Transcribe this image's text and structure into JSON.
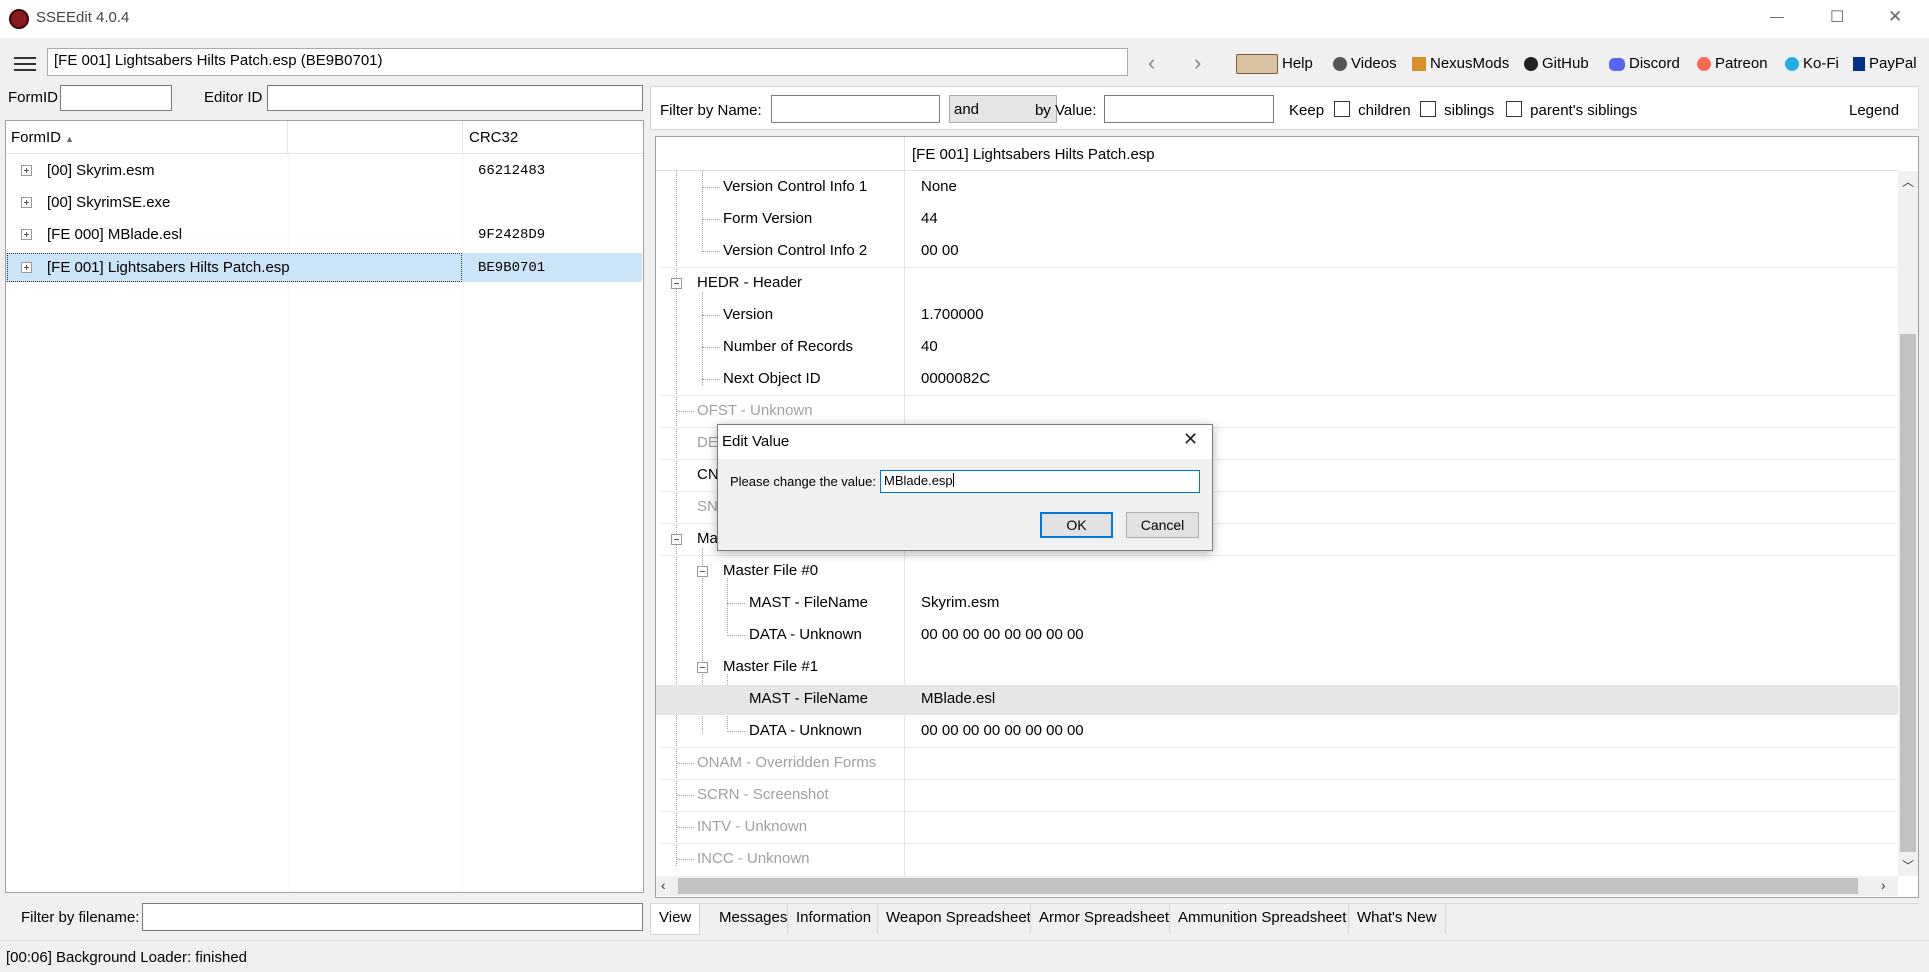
{
  "window": {
    "title": "SSEEdit 4.0.4",
    "buttons": {
      "minimize": "—",
      "maximize": "☐",
      "close": "✕"
    }
  },
  "toolbar": {
    "address": "[FE 001] Lightsabers Hilts Patch.esp (BE9B0701)",
    "links": [
      "Help",
      "Videos",
      "NexusMods",
      "GitHub",
      "Discord",
      "Patreon",
      "Ko-Fi",
      "PayPal"
    ]
  },
  "left": {
    "formid_label": "FormID",
    "formid_value": "",
    "editorid_label": "Editor ID",
    "editorid_value": "",
    "columns": [
      "FormID",
      "CRC32"
    ],
    "files": [
      {
        "name": "[00] Skyrim.esm",
        "crc": "66212483"
      },
      {
        "name": "[00] SkyrimSE.exe",
        "crc": ""
      },
      {
        "name": "[FE 000] MBlade.esl",
        "crc": "9F2428D9"
      },
      {
        "name": "[FE 001] Lightsabers Hilts Patch.esp",
        "crc": "BE9B0701"
      }
    ],
    "filter_label": "Filter by filename:",
    "filter_value": ""
  },
  "right": {
    "filter_name_label": "Filter by Name:",
    "filter_name_value": "",
    "operator": "and",
    "filter_value_label": "by Value:",
    "filter_value_value": "",
    "keep_label": "Keep",
    "checkboxes": [
      "children",
      "siblings",
      "parent's siblings"
    ],
    "legend": "Legend",
    "column_header": "[FE 001] Lightsabers Hilts Patch.esp",
    "rows": [
      {
        "label": "Version Control Info 1",
        "value": "None"
      },
      {
        "label": "Form Version",
        "value": "44"
      },
      {
        "label": "Version Control Info 2",
        "value": "00 00"
      },
      {
        "label": "HEDR - Header",
        "value": ""
      },
      {
        "label": "Version",
        "value": "1.700000"
      },
      {
        "label": "Number of Records",
        "value": "40"
      },
      {
        "label": "Next Object ID",
        "value": "0000082C"
      },
      {
        "label": "OFST - Unknown",
        "value": ""
      },
      {
        "label": "DE",
        "value": ""
      },
      {
        "label": "CN",
        "value": ""
      },
      {
        "label": "SN",
        "value": ""
      },
      {
        "label": "Ma",
        "value": ""
      },
      {
        "label": "Master File #0",
        "value": ""
      },
      {
        "label": "MAST - FileName",
        "value": "Skyrim.esm"
      },
      {
        "label": "DATA - Unknown",
        "value": "00 00 00 00 00 00 00 00"
      },
      {
        "label": "Master File #1",
        "value": ""
      },
      {
        "label": "MAST - FileName",
        "value": "MBlade.esl"
      },
      {
        "label": "DATA - Unknown",
        "value": "00 00 00 00 00 00 00 00"
      },
      {
        "label": "ONAM - Overridden Forms",
        "value": ""
      },
      {
        "label": "SCRN - Screenshot",
        "value": ""
      },
      {
        "label": "INTV - Unknown",
        "value": ""
      },
      {
        "label": "INCC - Unknown",
        "value": ""
      }
    ],
    "tabs": [
      "View",
      "Messages",
      "Information",
      "Weapon Spreadsheet",
      "Armor Spreadsheet",
      "Ammunition Spreadsheet",
      "What's New"
    ]
  },
  "dialog": {
    "title": "Edit Value",
    "prompt": "Please change the value:",
    "value": "MBlade.esp",
    "ok": "OK",
    "cancel": "Cancel"
  },
  "status": "[00:06] Background Loader: finished"
}
